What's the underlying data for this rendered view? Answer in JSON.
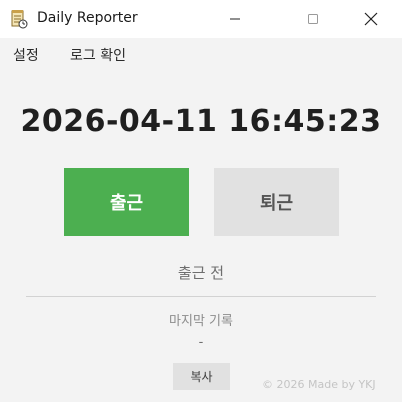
{
  "window": {
    "title": "Daily Reporter",
    "icon": "notepad-clock-icon",
    "controls": {
      "minimize": "minimize-icon",
      "maximize": "maximize-icon",
      "close": "close-icon"
    }
  },
  "menu": {
    "settings": "설정",
    "log": "로그 확인"
  },
  "clock": "2026-04-11 16:45:23",
  "buttons": {
    "clock_in": "출근",
    "clock_out": "퇴근",
    "copy": "복사"
  },
  "status": "출근 전",
  "last_record": {
    "label": "마지막 기록",
    "value": "-"
  },
  "footer": "© 2026 Made by YKJ",
  "colors": {
    "clock_in": "#4caf50",
    "clock_out": "#e1e1e1",
    "background": "#f3f3f3"
  }
}
